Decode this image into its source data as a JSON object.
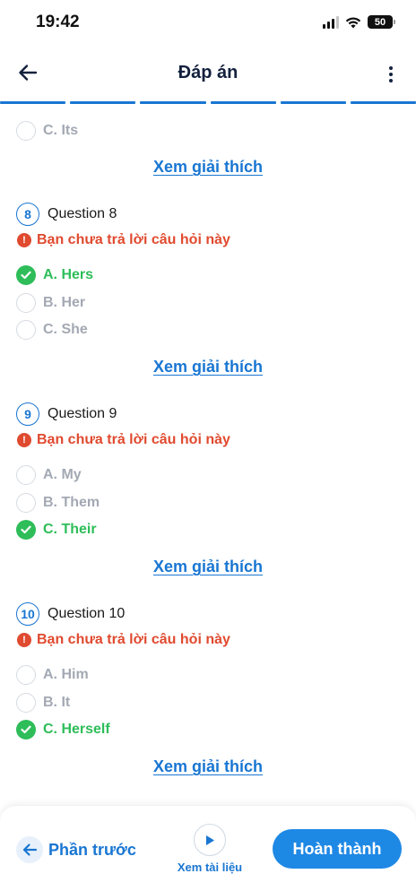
{
  "status": {
    "time": "19:42",
    "battery": "50"
  },
  "header": {
    "title": "Đáp án"
  },
  "progress": {
    "segments": 6
  },
  "top_option": {
    "label": "C. Its"
  },
  "explain_label": "Xem giải thích",
  "questions": [
    {
      "number": "8",
      "title": "Question 8",
      "warning": "Bạn chưa trả lời câu hỏi này",
      "options": [
        {
          "label": "A. Hers",
          "correct": true
        },
        {
          "label": "B. Her",
          "correct": false
        },
        {
          "label": "C. She",
          "correct": false
        }
      ]
    },
    {
      "number": "9",
      "title": "Question 9",
      "warning": "Bạn chưa trả lời câu hỏi này",
      "options": [
        {
          "label": "A. My",
          "correct": false
        },
        {
          "label": "B. Them",
          "correct": false
        },
        {
          "label": "C. Their",
          "correct": true
        }
      ]
    },
    {
      "number": "10",
      "title": "Question 10",
      "warning": "Bạn chưa trả lời câu hỏi này",
      "options": [
        {
          "label": "A. Him",
          "correct": false
        },
        {
          "label": "B. It",
          "correct": false
        },
        {
          "label": "C. Herself",
          "correct": true
        }
      ]
    }
  ],
  "bottom": {
    "prev_label": "Phần trước",
    "doc_label": "Xem tài liệu",
    "finish_label": "Hoàn thành"
  },
  "colors": {
    "accent": "#1976d2",
    "correct": "#2ebd59",
    "warning": "#e04a2f",
    "muted": "#a3a9b3"
  }
}
